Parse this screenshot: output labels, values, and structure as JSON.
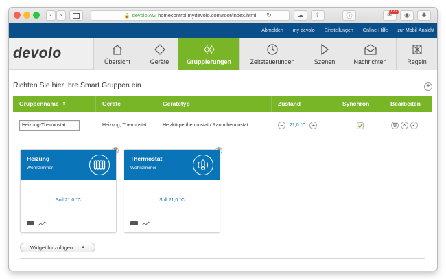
{
  "browser": {
    "url_host": "devolo AG",
    "url_rest": "homecontrol.mydevolo.com/root/index.html",
    "badge_count": "122"
  },
  "topnav": [
    "Abmelden",
    "my devolo",
    "Einstellungen",
    "Online-Hilfe",
    "zur Mobil-Ansicht"
  ],
  "logo": "devolo",
  "nav_tabs": [
    {
      "label": "Übersicht",
      "icon": "home-icon"
    },
    {
      "label": "Geräte",
      "icon": "diamond-icon"
    },
    {
      "label": "Gruppierungen",
      "icon": "group-icon"
    },
    {
      "label": "Zeitsteuerungen",
      "icon": "clock-icon"
    },
    {
      "label": "Szenen",
      "icon": "play-icon"
    },
    {
      "label": "Nachrichten",
      "icon": "envelope-icon"
    },
    {
      "label": "Regeln",
      "icon": "rules-icon"
    }
  ],
  "page_title": "Richten Sie hier Ihre Smart Gruppen ein.",
  "table": {
    "headers": [
      "Gruppenname",
      "Geräte",
      "Gerätetyp",
      "Zustand",
      "Synchron",
      "Bearbeiten"
    ],
    "row": {
      "name": "Heizung-Thermostat",
      "devices": "Heizung, Thermostat",
      "device_type": "Heizkörperthermostat / Raumthermostat",
      "state": "21,0 °C",
      "minus": "−",
      "plus": "+"
    }
  },
  "widgets": [
    {
      "title": "Heizung",
      "room": "Wohnzimmer",
      "soll": "Soll 21,0 °C",
      "icon": "radiator-icon"
    },
    {
      "title": "Thermostat",
      "room": "Wohnzimmer",
      "soll": "Soll 21,0 °C",
      "icon": "thermometer-icon"
    }
  ],
  "add_widget": "Widget hinzufügen",
  "colors": {
    "green": "#78b527",
    "blue_dark": "#0a4f8a",
    "widget_blue": "#0a74b9"
  }
}
